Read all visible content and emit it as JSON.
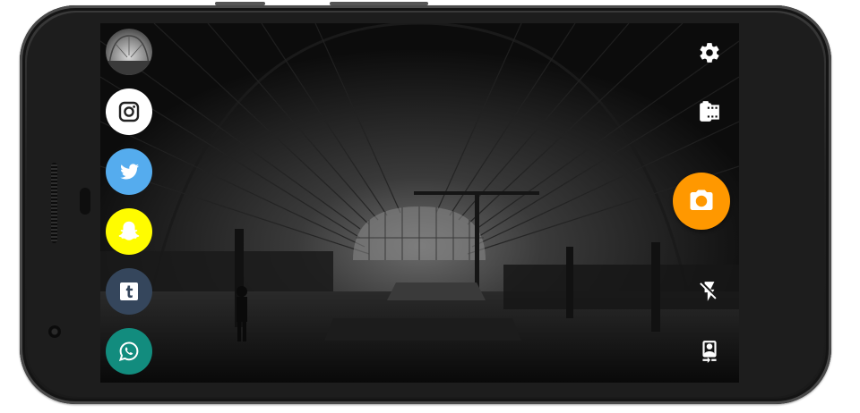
{
  "app": {
    "screen": "camera"
  },
  "colors": {
    "instagram_bg": "#ffffff",
    "twitter_bg": "#55acee",
    "snapchat_bg": "#fffc00",
    "tumblr_bg": "#35465c",
    "whatsapp_bg": "#128c7e",
    "shutter_bg": "#ff9800",
    "icon_light": "#ffffff"
  },
  "share_targets": [
    {
      "name": "gallery-thumbnail",
      "icon": "photo-thumbnail"
    },
    {
      "name": "instagram",
      "icon": "instagram-icon"
    },
    {
      "name": "twitter",
      "icon": "twitter-icon"
    },
    {
      "name": "snapchat",
      "icon": "snapchat-icon"
    },
    {
      "name": "tumblr",
      "icon": "tumblr-icon"
    },
    {
      "name": "whatsapp",
      "icon": "whatsapp-icon"
    }
  ],
  "controls": [
    {
      "name": "settings",
      "icon": "gear-icon"
    },
    {
      "name": "video-mode",
      "icon": "film-roll-icon"
    },
    {
      "name": "shutter",
      "icon": "camera-icon"
    },
    {
      "name": "flash",
      "icon": "flash-off-icon"
    },
    {
      "name": "switch-camera",
      "icon": "switch-camera-icon"
    }
  ]
}
